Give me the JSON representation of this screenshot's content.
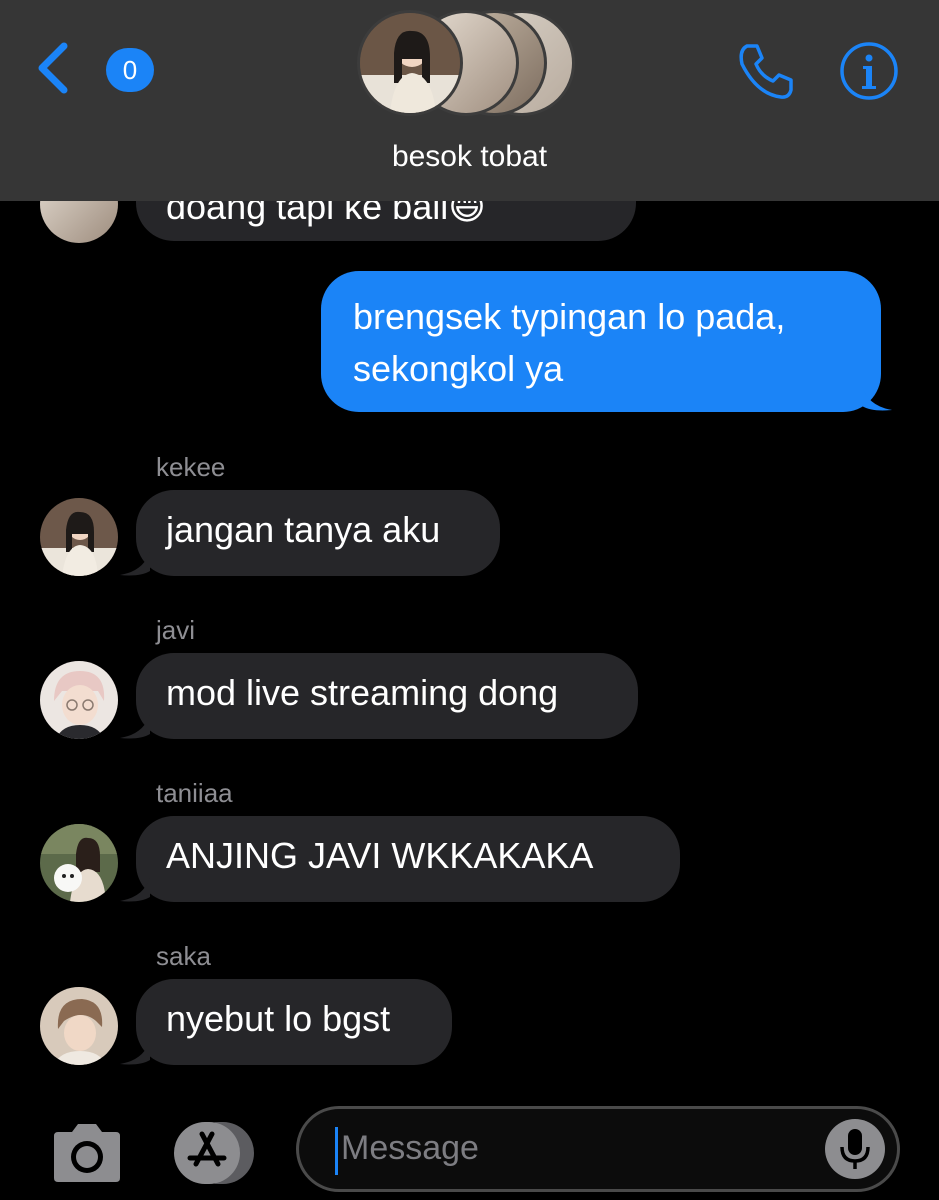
{
  "header": {
    "back_badge": "0",
    "group_name": "besok tobat",
    "icons": {
      "back": "chevron-left-icon",
      "call": "phone-icon",
      "info": "info-icon"
    }
  },
  "messages": [
    {
      "type": "in",
      "text": "doang tapi ke bali😄",
      "partial": true
    },
    {
      "type": "out",
      "line1": "brengsek typingan lo pada,",
      "line2": "sekongkol ya"
    },
    {
      "type": "in",
      "sender": "kekee",
      "text": "jangan tanya aku"
    },
    {
      "type": "in",
      "sender": "javi",
      "text": "mod live streaming dong"
    },
    {
      "type": "in",
      "sender": "taniiaa",
      "text": "ANJING JAVI WKKAKAKA"
    },
    {
      "type": "in",
      "sender": "saka",
      "text": "nyebut lo bgst"
    }
  ],
  "input": {
    "placeholder": "Message",
    "icons": {
      "camera": "camera-icon",
      "apps": "app-store-icon",
      "mic": "microphone-icon"
    }
  },
  "colors": {
    "accent": "#1b84f7",
    "incoming_bubble": "#262629",
    "header_bg": "#363636"
  }
}
